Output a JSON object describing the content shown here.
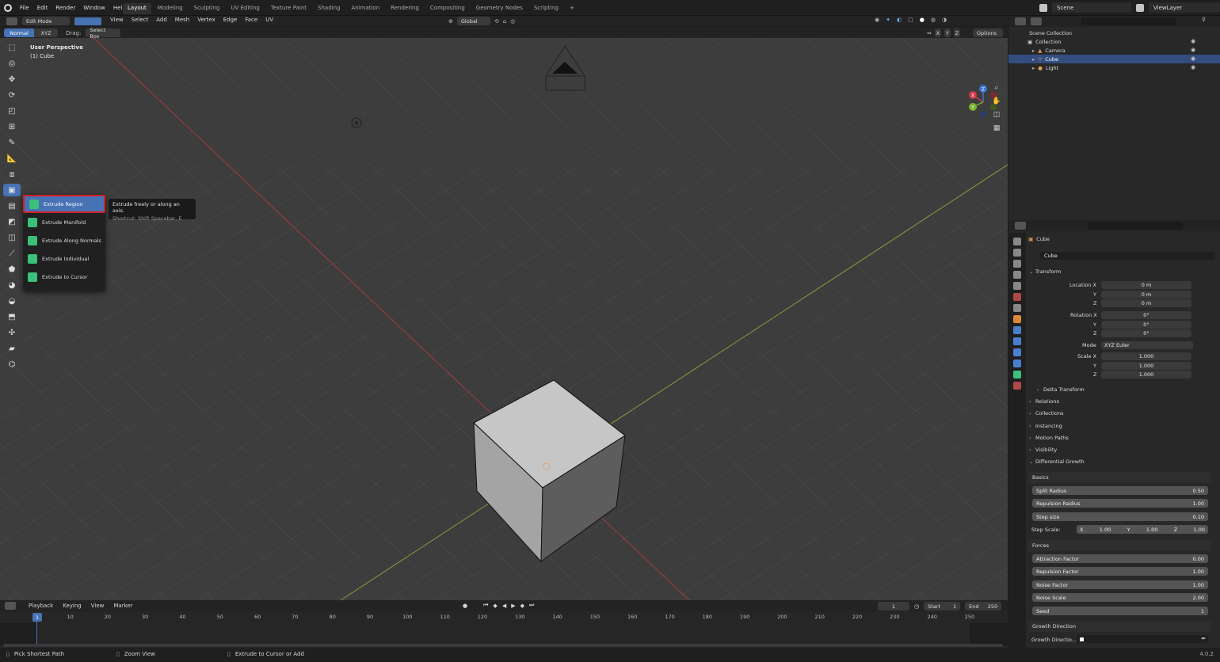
{
  "topbar": {
    "menus": [
      "File",
      "Edit",
      "Render",
      "Window",
      "Help"
    ],
    "workspaces": [
      "Layout",
      "Modeling",
      "Sculpting",
      "UV Editing",
      "Texture Paint",
      "Shading",
      "Animation",
      "Rendering",
      "Compositing",
      "Geometry Nodes",
      "Scripting",
      "+"
    ],
    "active_workspace": "Layout",
    "scene": "Scene",
    "viewlayer": "ViewLayer"
  },
  "viewport_header": {
    "mode": "Edit Mode",
    "menus": [
      "View",
      "Select",
      "Add",
      "Mesh",
      "Vertex",
      "Edge",
      "Face",
      "UV"
    ],
    "transform_orientation": "Global",
    "orient_normal": "Normal",
    "orient_xyz": "XYZ",
    "drag_label": "Drag:",
    "drag_value": "Select Box",
    "options": "Options",
    "axis_x": "X",
    "axis_y": "Y",
    "axis_z": "Z"
  },
  "viewport": {
    "perspective": "User Perspective",
    "object": "(1) Cube"
  },
  "flyout": {
    "items": [
      "Extrude Region",
      "Extrude Manifold",
      "Extrude Along Normals",
      "Extrude Individual",
      "Extrude to Cursor"
    ]
  },
  "tooltip": {
    "text": "Extrude freely or along an axis.",
    "shortcut": "Shortcut: Shift Spacebar, E"
  },
  "gizmo": {
    "x": "X",
    "y": "Y",
    "z": "Z"
  },
  "outliner": {
    "rows": [
      "Scene Collection",
      "Collection",
      "Camera",
      "Cube",
      "Light"
    ]
  },
  "timeline": {
    "menus": [
      "Playback",
      "Keying",
      "View",
      "Marker"
    ],
    "current_frame": "1",
    "start_label": "Start",
    "start": "1",
    "end_label": "End",
    "end": "250",
    "ticks": [
      "1",
      "10",
      "20",
      "30",
      "40",
      "50",
      "60",
      "70",
      "80",
      "90",
      "100",
      "110",
      "120",
      "130",
      "140",
      "150",
      "160",
      "170",
      "180",
      "190",
      "200",
      "210",
      "220",
      "230",
      "240",
      "250"
    ],
    "frame_marker": "1"
  },
  "status": {
    "left": "Pick Shortest Path",
    "mid": "Zoom View",
    "right": "Extrude to Cursor or Add",
    "version": "4.0.2"
  },
  "props": {
    "object_name": "Cube",
    "object_field": "Cube",
    "transform": "Transform",
    "location_x_label": "Location X",
    "y_label": "Y",
    "z_label": "Z",
    "location": [
      "0 m",
      "0 m",
      "0 m"
    ],
    "rotation_x_label": "Rotation X",
    "rotation": [
      "0°",
      "0°",
      "0°"
    ],
    "mode_label": "Mode",
    "mode": "XYZ Euler",
    "scale_x_label": "Scale X",
    "scale": [
      "1.000",
      "1.000",
      "1.000"
    ],
    "delta_transform": "Delta Transform",
    "sections": [
      "Relations",
      "Collections",
      "Instancing",
      "Motion Paths",
      "Visibility"
    ],
    "diff_growth": "Differential Growth",
    "basics": "Basics",
    "split_radius_label": "Split Radius",
    "split_radius": "0.50",
    "repulsion_radius_label": "Repulsion Radius",
    "repulsion_radius": "1.00",
    "step_size_label": "Step size",
    "step_size": "0.10",
    "step_scale_label": "Step Scale:",
    "step_scale_x_label": "X",
    "step_scale_x": "1.00",
    "step_scale_y_label": "Y",
    "step_scale_y": "1.00",
    "step_scale_z_label": "Z",
    "step_scale_z": "1.00",
    "forces": "Forces",
    "attraction_label": "Attraction Factor",
    "attraction": "0.00",
    "repulsion_factor_label": "Repulsion Factor",
    "repulsion_factor": "1.00",
    "noise_factor_label": "Noise Factor",
    "noise_factor": "1.00",
    "noise_scale_label": "Noise Scale",
    "noise_scale": "2.00",
    "seed_label": "Seed",
    "seed": "1",
    "growth_direction": "Growth Direction",
    "growth_direction_field": "Growth Directio..."
  }
}
